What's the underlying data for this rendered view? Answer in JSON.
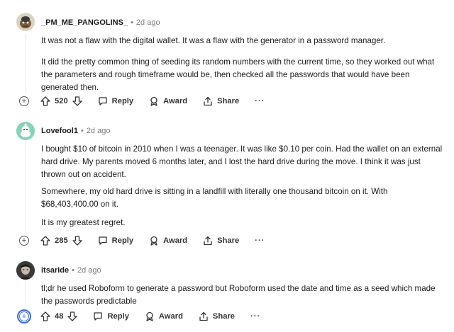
{
  "comments": [
    {
      "username": "_PM_ME_PANGOLINS_",
      "time": "2d ago",
      "paragraphs": [
        "It was not a flaw with the digital wallet. It was a flaw with the generator in a password manager.",
        "It did the pretty common thing of seeding its random numbers with the current time, so they worked out what the parameters and rough timeframe would be, then checked all the passwords that would have been generated then."
      ],
      "votes": "520",
      "actions": {
        "reply": "Reply",
        "award": "Award",
        "share": "Share",
        "more": "···"
      }
    },
    {
      "username": "Lovefool1",
      "time": "2d ago",
      "paragraphs": [
        "I bought $10 of bitcoin in 2010 when I was a teenager. It was like $0.10 per coin. Had the wallet on an external hard drive. My parents moved 6 months later, and I lost the hard drive during the move. I think it was just thrown out on accident.",
        "Somewhere, my old hard drive is sitting in a landfill with literally one thousand bitcoin on it. With $68,403,400.00 on it.",
        "It is my greatest regret."
      ],
      "votes": "285",
      "actions": {
        "reply": "Reply",
        "award": "Award",
        "share": "Share",
        "more": "···"
      }
    },
    {
      "username": "itsaride",
      "time": "2d ago",
      "paragraphs": [
        "tl;dr he used Roboform to generate a password but Roboform used the date and time as a seed which made the passwords predictable"
      ],
      "votes": "48",
      "actions": {
        "reply": "Reply",
        "award": "Award",
        "share": "Share",
        "more": "···"
      }
    }
  ],
  "separator": "•",
  "expand_symbol": "+"
}
